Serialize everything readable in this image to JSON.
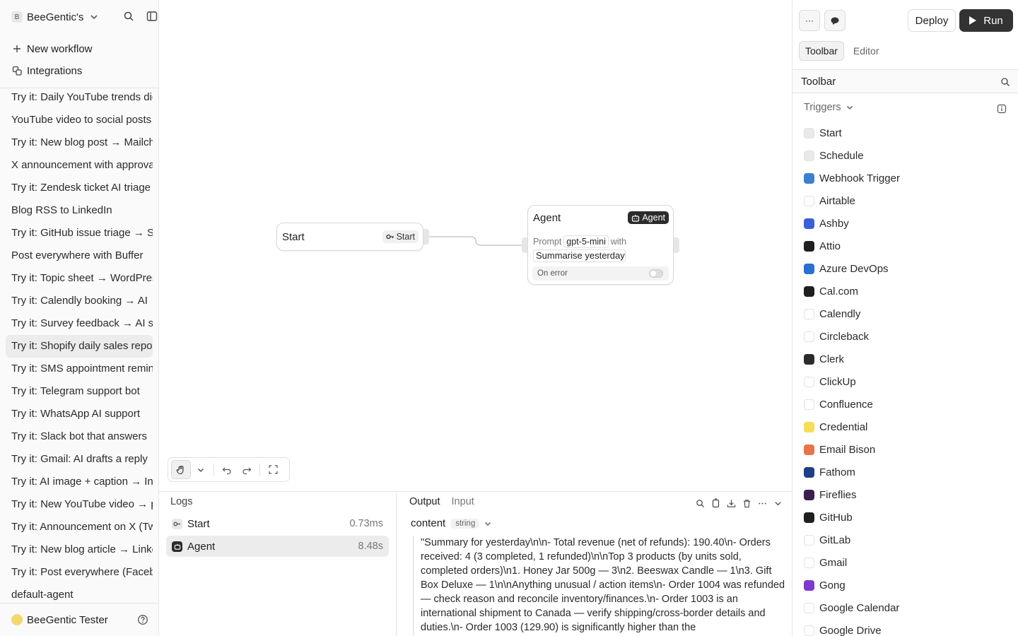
{
  "sidebar": {
    "workspace_initial": "B",
    "workspace_name": "BeeGentic's",
    "new_workflow": "New workflow",
    "integrations": "Integrations",
    "workflows": [
      "Try it: Daily YouTube trends digest",
      "YouTube video to social posts",
      "Try it: New blog post → Mailchimp",
      "X announcement with approval",
      "Try it: Zendesk ticket AI triage",
      "Blog RSS to LinkedIn",
      "Try it: GitHub issue triage → Slack",
      "Post everywhere with Buffer",
      "Try it: Topic sheet → WordPress",
      "Try it: Calendly booking → AI",
      "Try it: Survey feedback → AI summary",
      "Try it: Shopify daily sales report",
      "Try it: SMS appointment reminders",
      "Try it: Telegram support bot",
      "Try it: WhatsApp AI support",
      "Try it: Slack bot that answers",
      "Try it: Gmail: AI drafts a reply",
      "Try it: AI image + caption → Instagram",
      "Try it: New YouTube video → post",
      "Try it: Announcement on X (Twitter)",
      "Try it: New blog article → LinkedIn",
      "Try it: Post everywhere (Facebook)",
      "default-agent"
    ],
    "active_index": 11,
    "user_name": "BeeGentic Tester"
  },
  "canvas": {
    "start_node": {
      "title": "Start",
      "tag": "Start"
    },
    "agent_node": {
      "title": "Agent",
      "tag": "Agent",
      "prompt_label": "Prompt",
      "model": "gpt-5-mini",
      "with_label": "with",
      "prompt_text": "Summarise yesterday",
      "on_error": "On error"
    }
  },
  "logs": {
    "title": "Logs",
    "rows": [
      {
        "name": "Start",
        "duration": "0.73ms"
      },
      {
        "name": "Agent",
        "duration": "8.48s"
      }
    ]
  },
  "output": {
    "tabs": [
      "Output",
      "Input"
    ],
    "field_name": "content",
    "field_type": "string",
    "content": "\"Summary for yesterday\\n\\n- Total revenue (net of refunds): 190.40\\n- Orders received: 4 (3 completed, 1 refunded)\\n\\nTop 3 products (by units sold, completed orders)\\n1. Honey Jar 500g — 3\\n2. Beeswax Candle — 1\\n3. Gift Box Deluxe — 1\\n\\nAnything unusual / action items\\n- Order 1004 was refunded — check reason and reconcile inventory/finances.\\n- Order 1003 is an international shipment to Canada — verify shipping/cross-border details and duties.\\n- Order 1003 (129.90) is significantly higher than the"
  },
  "right_panel": {
    "more_label": "···",
    "deploy": "Deploy",
    "run": "Run",
    "tabs": [
      "Toolbar",
      "Editor"
    ],
    "header": "Toolbar",
    "section": "Triggers",
    "items": [
      {
        "name": "Start",
        "color": "#e9e9e9"
      },
      {
        "name": "Schedule",
        "color": "#e9e9e9"
      },
      {
        "name": "Webhook Trigger",
        "color": "#3b7fd1"
      },
      {
        "name": "Airtable",
        "color": "#ffffff"
      },
      {
        "name": "Ashby",
        "color": "#3a5fd8"
      },
      {
        "name": "Attio",
        "color": "#1f1f1f"
      },
      {
        "name": "Azure DevOps",
        "color": "#2b6fd1"
      },
      {
        "name": "Cal.com",
        "color": "#1f1f1f"
      },
      {
        "name": "Calendly",
        "color": "#ffffff"
      },
      {
        "name": "Circleback",
        "color": "#ffffff"
      },
      {
        "name": "Clerk",
        "color": "#2b2b2b"
      },
      {
        "name": "ClickUp",
        "color": "#ffffff"
      },
      {
        "name": "Confluence",
        "color": "#ffffff"
      },
      {
        "name": "Credential",
        "color": "#f6dd57"
      },
      {
        "name": "Email Bison",
        "color": "#e8744a"
      },
      {
        "name": "Fathom",
        "color": "#1d3f87"
      },
      {
        "name": "Fireflies",
        "color": "#3b1f4f"
      },
      {
        "name": "GitHub",
        "color": "#1f1f1f"
      },
      {
        "name": "GitLab",
        "color": "#ffffff"
      },
      {
        "name": "Gmail",
        "color": "#ffffff"
      },
      {
        "name": "Gong",
        "color": "#7c3ad1"
      },
      {
        "name": "Google Calendar",
        "color": "#ffffff"
      },
      {
        "name": "Google Drive",
        "color": "#ffffff"
      }
    ]
  }
}
